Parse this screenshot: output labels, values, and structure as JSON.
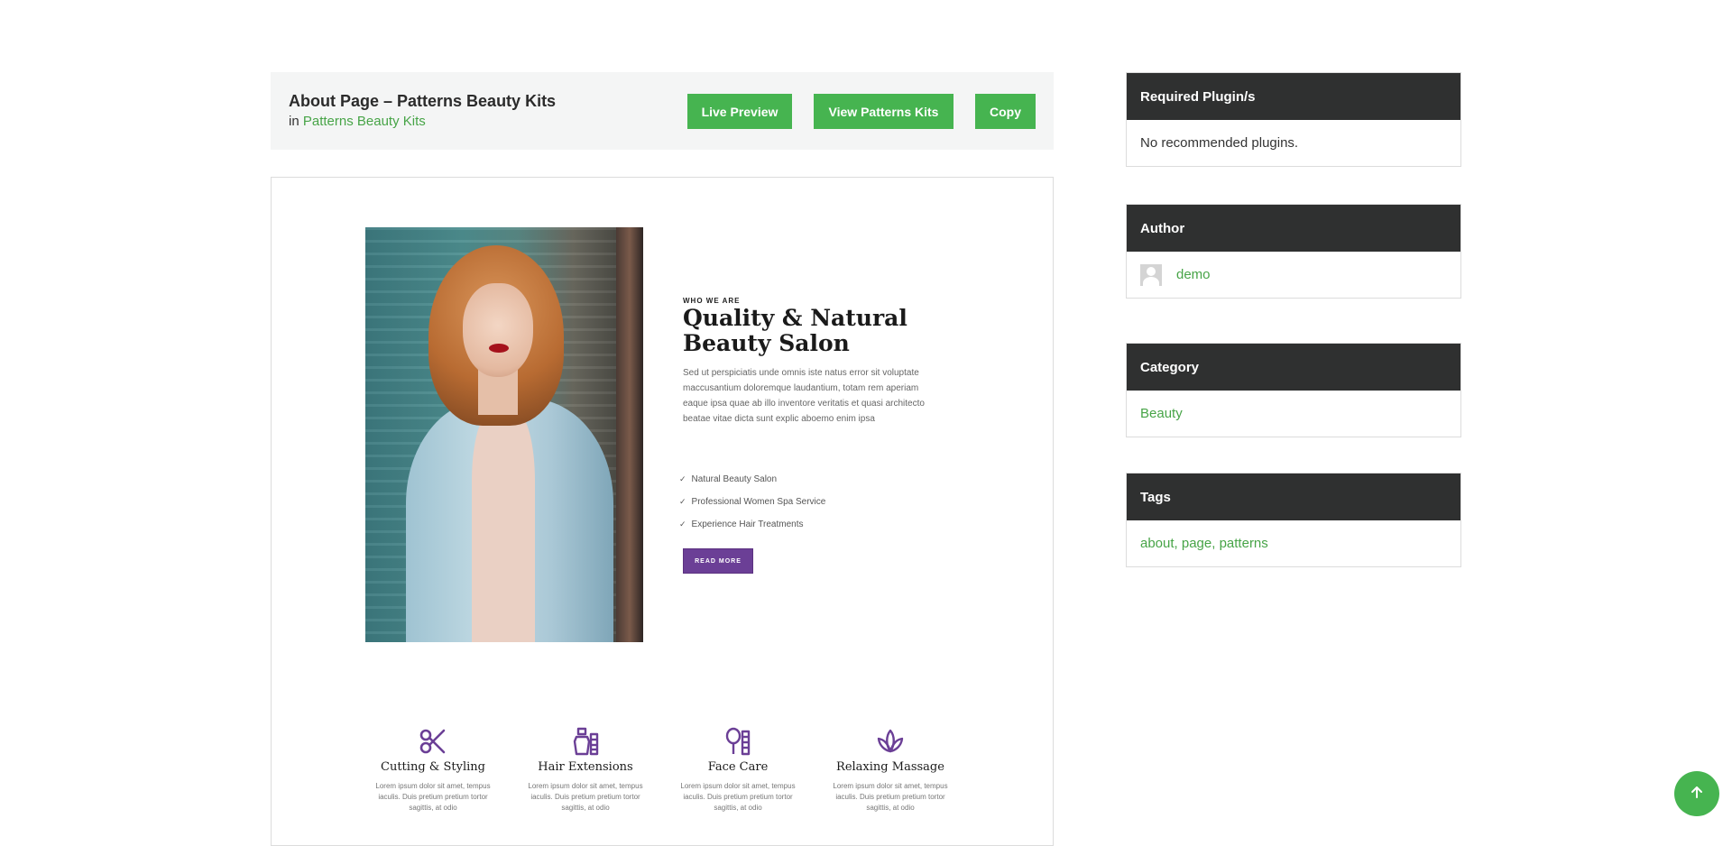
{
  "header": {
    "title": "About Page – Patterns Beauty Kits",
    "in_label": "in",
    "category_link": "Patterns Beauty Kits",
    "buttons": {
      "live_preview": "Live Preview",
      "view_kits": "View Patterns Kits",
      "copy": "Copy"
    }
  },
  "preview": {
    "eyebrow": "WHO WE ARE",
    "headline_line1": "Quality & Natural",
    "headline_line2": "Beauty Salon",
    "paragraph": "Sed ut perspiciatis unde omnis iste natus error sit voluptate maccusantium doloremque laudantium, totam rem aperiam eaque ipsa quae ab illo inventore veritatis et quasi architecto beatae vitae dicta sunt explic aboemo enim ipsa",
    "checklist": [
      "Natural Beauty Salon",
      "Professional Women Spa Service",
      "Experience Hair Treatments"
    ],
    "read_more": "READ MORE",
    "services": [
      {
        "title": "Cutting & Styling",
        "desc": "Lorem ipsum dolor sit amet, tempus iaculis. Duis pretium pretium tortor sagittis, at odio",
        "icon": "scissors-icon"
      },
      {
        "title": "Hair Extensions",
        "desc": "Lorem ipsum dolor sit amet, tempus iaculis. Duis pretium pretium tortor sagittis, at odio",
        "icon": "hair-product-icon"
      },
      {
        "title": "Face Care",
        "desc": "Lorem ipsum dolor sit amet, tempus iaculis. Duis pretium pretium tortor sagittis, at odio",
        "icon": "mirror-comb-icon"
      },
      {
        "title": "Relaxing Massage",
        "desc": "Lorem ipsum dolor sit amet, tempus iaculis. Duis pretium pretium tortor sagittis, at odio",
        "icon": "lotus-icon"
      }
    ]
  },
  "sidebar": {
    "required_plugins": {
      "heading": "Required Plugin/s",
      "body": "No recommended plugins."
    },
    "author": {
      "heading": "Author",
      "name": "demo"
    },
    "category": {
      "heading": "Category",
      "value": "Beauty"
    },
    "tags": {
      "heading": "Tags",
      "value": "about, page, patterns"
    }
  },
  "colors": {
    "accent": "#46b450",
    "dark": "#2f3030",
    "purple": "#6b3f96"
  }
}
